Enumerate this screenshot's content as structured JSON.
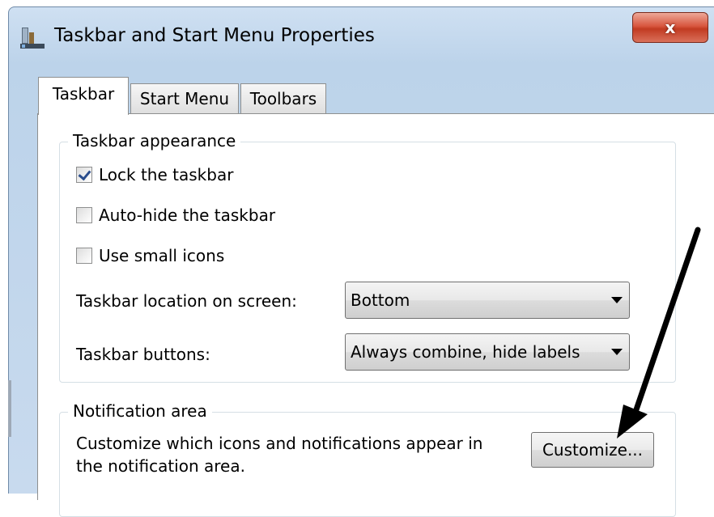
{
  "window": {
    "title": "Taskbar and Start Menu Properties",
    "close_label": "x"
  },
  "tabs": [
    {
      "label": "Taskbar",
      "active": true
    },
    {
      "label": "Start Menu",
      "active": false
    },
    {
      "label": "Toolbars",
      "active": false
    }
  ],
  "appearance": {
    "legend": "Taskbar appearance",
    "options": [
      {
        "label": "Lock the taskbar",
        "checked": true
      },
      {
        "label": "Auto-hide the taskbar",
        "checked": false
      },
      {
        "label": "Use small icons",
        "checked": false
      }
    ],
    "location_label": "Taskbar location on screen:",
    "location_value": "Bottom",
    "buttons_label": "Taskbar buttons:",
    "buttons_value": "Always combine, hide labels"
  },
  "notification": {
    "legend": "Notification area",
    "description": "Customize which icons and notifications appear in the notification area.",
    "customize_label": "Customize..."
  },
  "colors": {
    "accent": "#2a4d8c",
    "close_red": "#c23b22",
    "window_frame": "#bcd3ea"
  }
}
